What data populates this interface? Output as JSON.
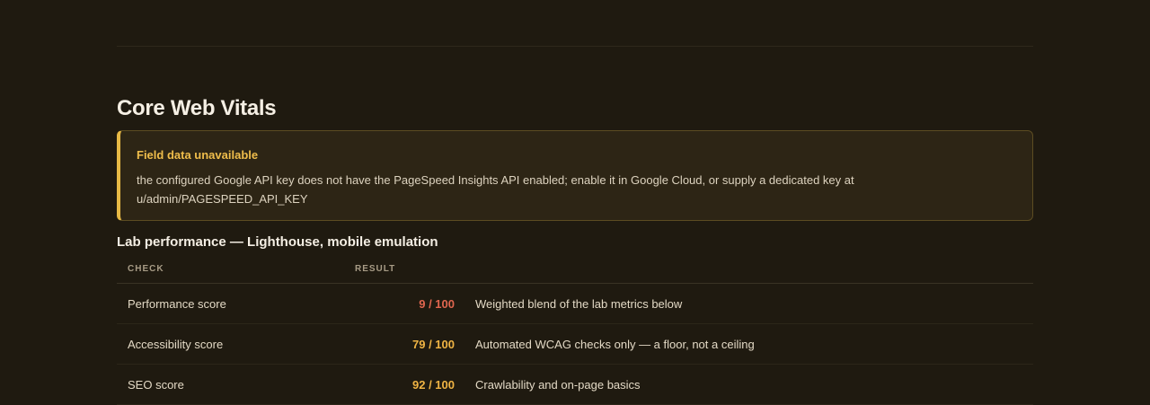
{
  "page": {
    "section_title": "Core Web Vitals"
  },
  "notice": {
    "title": "Field data unavailable",
    "body_line1": "the configured Google API key does not have the PageSpeed Insights API enabled; enable it in Google Cloud, or supply a dedicated key at",
    "body_line2": "u/admin/PAGESPEED_API_KEY",
    "accent_color": "#e7b945"
  },
  "lab": {
    "heading": "Lab performance — Lighthouse, mobile emulation",
    "columns": {
      "check": "CHECK",
      "result": "RESULT"
    },
    "rows": [
      {
        "check": "Performance score",
        "result": "9 / 100",
        "result_color": "#e0664f",
        "note": "Weighted blend of the lab metrics below"
      },
      {
        "check": "Accessibility score",
        "result": "79 / 100",
        "result_color": "#f0b444",
        "note": "Automated WCAG checks only — a floor, not a ceiling"
      },
      {
        "check": "SEO score",
        "result": "92 / 100",
        "result_color": "#f0b444",
        "note": "Crawlability and on-page basics"
      }
    ]
  }
}
